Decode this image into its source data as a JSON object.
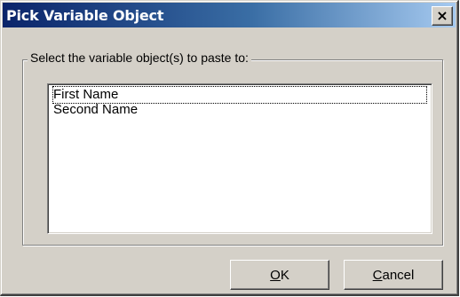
{
  "window": {
    "title": "Pick Variable Object",
    "close_glyph": "×"
  },
  "group": {
    "label": "Select the variable object(s) to paste to:"
  },
  "list": {
    "items": [
      "First Name",
      "Second Name"
    ],
    "focused_index": 0
  },
  "buttons": {
    "ok": {
      "mnemonic": "O",
      "rest": "K"
    },
    "cancel": {
      "mnemonic": "C",
      "rest": "ancel"
    }
  },
  "icons": {
    "close": "close-icon"
  }
}
